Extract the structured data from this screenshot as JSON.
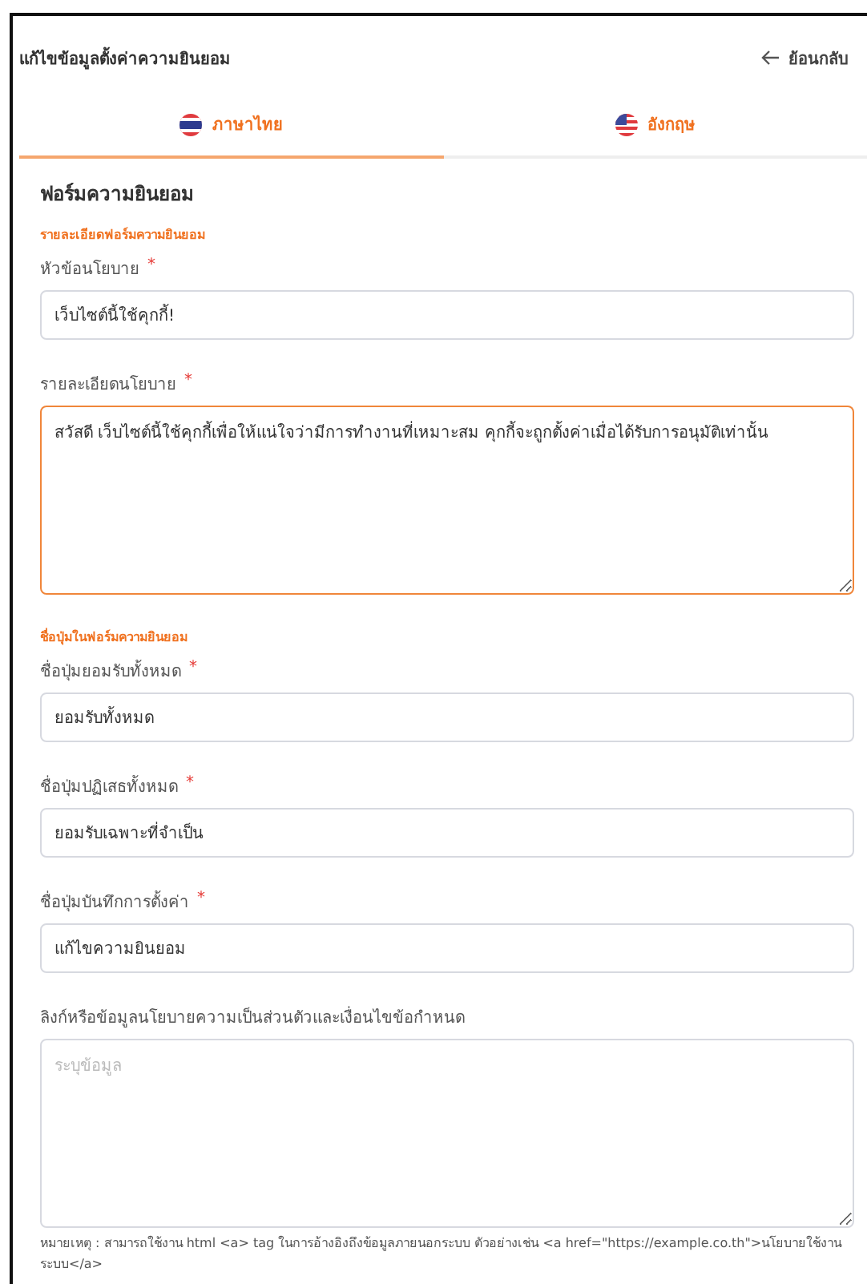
{
  "header": {
    "title": "แก้ไขข้อมูลตั้งค่าความยินยอม",
    "back": "ย้อนกลับ"
  },
  "tabs": [
    {
      "label": "ภาษาไทย",
      "kind": "thai",
      "selected": true
    },
    {
      "label": "อังกฤษ",
      "kind": "english",
      "selected": false
    }
  ],
  "form": {
    "title": "ฟอร์มความยินยอม",
    "sections": [
      {
        "heading": "รายละเอียดฟอร์มความยินยอม",
        "fields": [
          {
            "kind": "input",
            "label": "หัวข้อนโยบาย",
            "required_mark": "*",
            "value": "เว็บไซต์นี้ใช้คุกกี้!",
            "focused": false
          },
          {
            "kind": "textarea",
            "label": "รายละเอียดนโยบาย",
            "required_mark": "*",
            "value": "สวัสดี เว็บไซต์นี้ใช้คุกกี้เพื่อให้แน่ใจว่ามีการทำงานที่เหมาะสม คุกกี้จะถูกตั้งค่าเมื่อได้รับการอนุมัติเท่านั้น",
            "focused": true
          }
        ]
      },
      {
        "heading": "ชื่อปุ่มในฟอร์มความยินยอม",
        "fields": [
          {
            "kind": "input",
            "label": "ชื่อปุ่มยอมรับทั้งหมด",
            "required_mark": "*",
            "value": "ยอมรับทั้งหมด",
            "focused": false
          },
          {
            "kind": "input",
            "label": "ชื่อปุ่มปฏิเสธทั้งหมด",
            "required_mark": "*",
            "value": "ยอมรับเฉพาะที่จำเป็น",
            "focused": false
          },
          {
            "kind": "input",
            "label": "ชื่อปุ่มบันทึกการตั้งค่า",
            "required_mark": "*",
            "value": "แก้ไขความยินยอม",
            "focused": false
          },
          {
            "kind": "textarea",
            "label": "ลิงก์หรือข้อมูลนโยบายความเป็นส่วนตัวและเงื่อนไขข้อกำหนด",
            "placeholder": "ระบุข้อมูล",
            "focused": false,
            "note": "หมายเหตุ : สามารถใช้งาน html <a> tag ในการอ้างอิงถึงข้อมูลภายนอกระบบ ตัวอย่างเช่น <a href=\"https://example.co.th\">นโยบายใช้งานระบบ</a>"
          }
        ]
      }
    ]
  }
}
